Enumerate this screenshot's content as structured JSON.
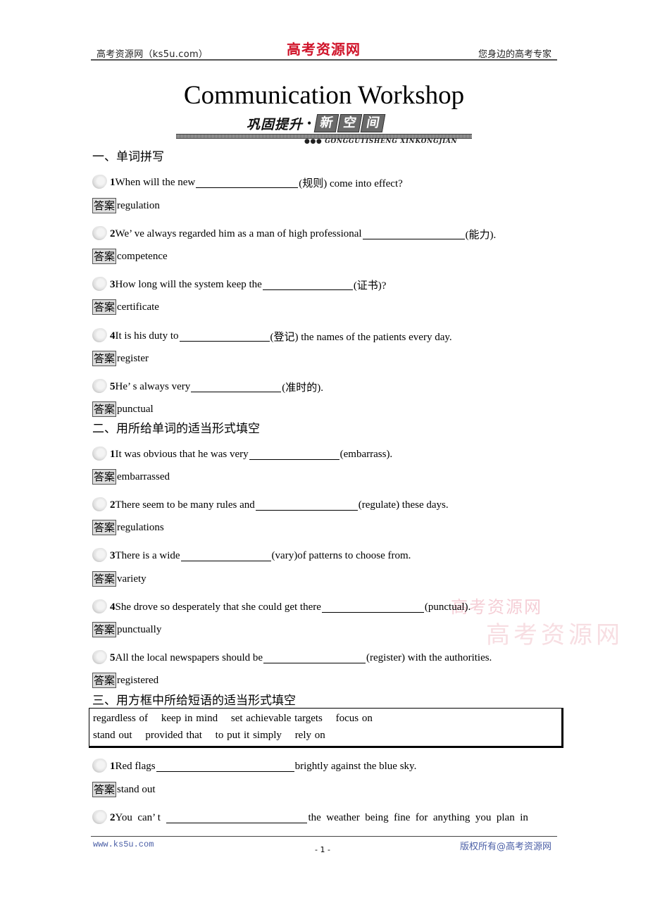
{
  "header": {
    "left": "高考资源网（ks5u.com）",
    "logo": "高考资源网",
    "right": "您身边的高考专家"
  },
  "title": "Communication Workshop",
  "banner": {
    "text": "巩固提升",
    "dot": "•",
    "boxes": [
      "新",
      "空",
      "间"
    ],
    "subtitle": "●●● GONGGUTISHENG XINKONGJIAN"
  },
  "answer_label": "答案",
  "sections": [
    {
      "title": "一、单词拼写",
      "questions": [
        {
          "num": "1",
          "before": "When will the new ",
          "after": "(规则) come into effect?",
          "answer": "regulation"
        },
        {
          "num": "2",
          "before": "We’ ve always regarded him as a man of high professional ",
          "after": "(能力).",
          "answer": "competence"
        },
        {
          "num": "3",
          "before": "How long will the system keep the ",
          "after": "(证书)?",
          "answer": "certificate"
        },
        {
          "num": "4",
          "before": "It is his duty to ",
          "after": "(登记) the names of the patients every day.",
          "answer": "register"
        },
        {
          "num": "5",
          "before": "He’ s always very ",
          "after": "(准时的).",
          "answer": "punctual"
        }
      ]
    },
    {
      "title": "二、用所给单词的适当形式填空",
      "questions": [
        {
          "num": "1",
          "before": "It was obvious that he was very ",
          "after": "(embarrass).",
          "answer": "embarrassed"
        },
        {
          "num": "2",
          "before": "There seem to be many rules and ",
          "after": "(regulate) these days.",
          "answer": "regulations"
        },
        {
          "num": "3",
          "before": "There is a wide ",
          "after": "(vary)of patterns to choose from.",
          "answer": "variety"
        },
        {
          "num": "4",
          "before": "She drove so desperately that she could get there ",
          "after": "(punctual).",
          "answer": "punctually"
        },
        {
          "num": "5",
          "before": "All the local newspapers should be ",
          "after": "(register) with the authorities.",
          "answer": "registered"
        }
      ]
    },
    {
      "title": "三、用方框中所给短语的适当形式填空",
      "phrases_row1": [
        "regardless of",
        "keep in mind",
        "set achievable targets",
        "focus on"
      ],
      "phrases_row2": [
        "stand out",
        "provided that",
        "to put it simply",
        "rely on"
      ],
      "questions": [
        {
          "num": "1",
          "before": "Red flags ",
          "after": "brightly against the blue sky.",
          "answer": "stand out"
        },
        {
          "num": "2",
          "before": "You  can’ t  ",
          "after": "the  weather  being  fine  for  anything  you  plan  in",
          "answer": null
        }
      ]
    }
  ],
  "watermark": {
    "line1": "高考资源网",
    "line2": "高考资源网"
  },
  "footer": {
    "left": "www.ks5u.com",
    "page": "- 1 -",
    "right": "版权所有@高考资源网"
  }
}
